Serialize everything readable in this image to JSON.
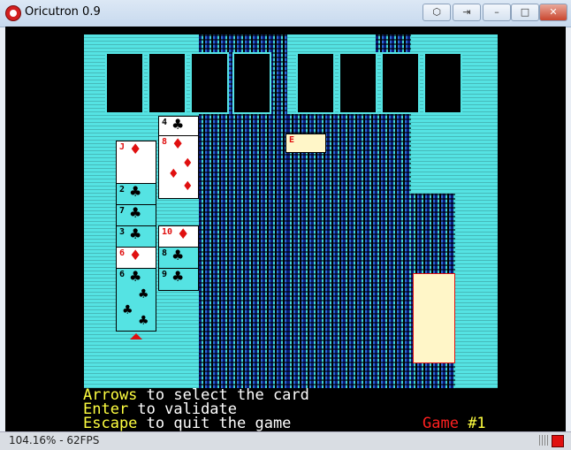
{
  "window": {
    "title": "Oricutron 0.9",
    "controls": {
      "minimize": "–",
      "maximize": "□",
      "close": "✕",
      "extra1": "⬡",
      "extra2": "⇥"
    }
  },
  "game": {
    "cards": [
      {
        "rank": "4",
        "suit": "♣",
        "color": "black"
      },
      {
        "rank": "8",
        "suit": "♦",
        "color": "red"
      },
      {
        "rank": "J",
        "suit": "♦",
        "color": "red"
      },
      {
        "rank": "2",
        "suit": "♣",
        "color": "black"
      },
      {
        "rank": "7",
        "suit": "♣",
        "color": "black"
      },
      {
        "rank": "3",
        "suit": "♣",
        "color": "black"
      },
      {
        "rank": "10",
        "suit": "♦",
        "color": "red"
      },
      {
        "rank": "6",
        "suit": "♦",
        "color": "red"
      },
      {
        "rank": "8",
        "suit": "♣",
        "color": "black"
      },
      {
        "rank": "6",
        "suit": "♣",
        "color": "black"
      },
      {
        "rank": "9",
        "suit": "♣",
        "color": "black"
      },
      {
        "rank": "E",
        "suit": "",
        "color": "red"
      }
    ],
    "instructions": {
      "line1_key": "Arrows",
      "line1_rest": " to select the card",
      "line2_key": "Enter",
      "line2_rest": " to validate",
      "line3_key": "Escape",
      "line3_rest": " to quit the game",
      "game_label": "Game ",
      "game_number": "#1"
    }
  },
  "status": {
    "zoom": "104.16%",
    "sep": " - ",
    "fps": "62FPS"
  },
  "colors": {
    "cyan": "#55e3e3",
    "yellow": "#ffff40",
    "red": "#ff2020",
    "black": "#000000"
  }
}
